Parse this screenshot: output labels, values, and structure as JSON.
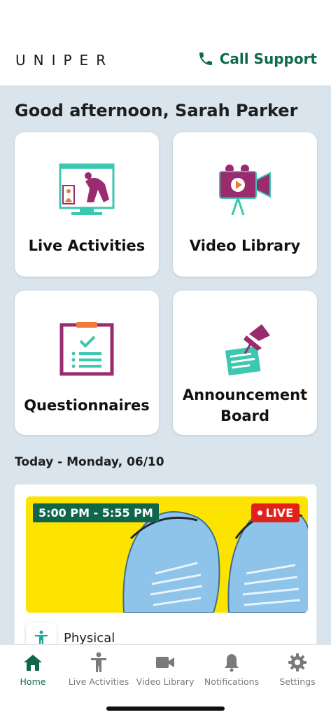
{
  "header": {
    "logo": "UNIPER",
    "call_support": "Call Support"
  },
  "greeting": "Good afternoon, Sarah Parker",
  "tiles": [
    {
      "label": "Live Activities",
      "icon": "live-activities-icon"
    },
    {
      "label": "Video Library",
      "icon": "video-camera-icon"
    },
    {
      "label": "Questionnaires",
      "icon": "clipboard-checklist-icon"
    },
    {
      "label": "Announcement Board",
      "icon": "pinned-note-icon"
    }
  ],
  "today_heading": "Today - Monday, 06/10",
  "activity": {
    "time": "5:00 PM - 5:55 PM",
    "live_label": "LIVE",
    "category": "Physical"
  },
  "tabbar": {
    "items": [
      {
        "label": "Home",
        "icon": "home-icon",
        "active": true
      },
      {
        "label": "Live Activities",
        "icon": "person-icon"
      },
      {
        "label": "Video Library",
        "icon": "video-icon"
      },
      {
        "label": "Notifications",
        "icon": "bell-icon"
      },
      {
        "label": "Settings",
        "icon": "gear-icon"
      }
    ]
  },
  "colors": {
    "brand_green": "#10664a",
    "background": "#d9e4ec",
    "live_red": "#e3211b",
    "banner_yellow": "#fde400",
    "teal": "#3cc7b1",
    "plum": "#9b2b6f"
  }
}
